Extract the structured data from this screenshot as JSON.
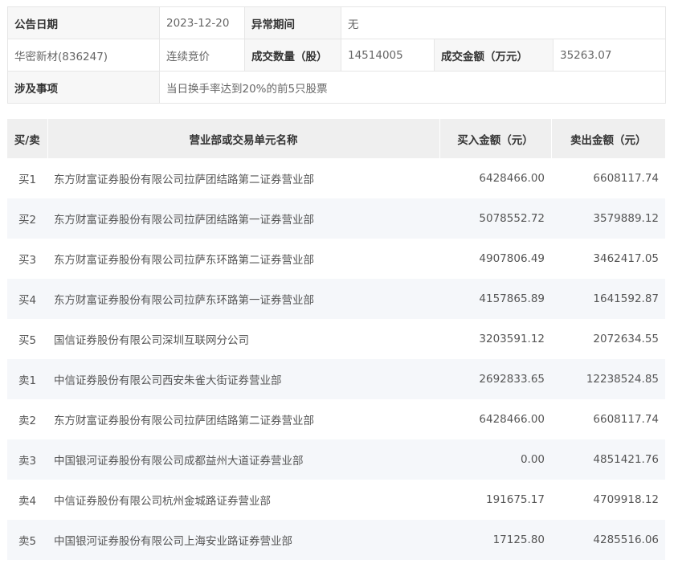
{
  "info": {
    "date_label": "公告日期",
    "date_value": "2023-12-20",
    "abnormal_label": "异常期间",
    "abnormal_value": "无",
    "stock_name": "华密新材(836247)",
    "trade_type": "连续竞价",
    "volume_label": "成交数量（股）",
    "volume_value": "14514005",
    "amount_label": "成交金额（万元）",
    "amount_value": "35263.07",
    "matter_label": "涉及事项",
    "matter_value": "当日换手率达到20%的前5只股票"
  },
  "table": {
    "headers": {
      "side": "买/卖",
      "name": "营业部或交易单元名称",
      "buy": "买入金额（元）",
      "sell": "卖出金额（元）"
    },
    "rows": [
      {
        "side": "买1",
        "name": "东方财富证券股份有限公司拉萨团结路第二证券营业部",
        "buy": "6428466.00",
        "sell": "6608117.74"
      },
      {
        "side": "买2",
        "name": "东方财富证券股份有限公司拉萨团结路第一证券营业部",
        "buy": "5078552.72",
        "sell": "3579889.12"
      },
      {
        "side": "买3",
        "name": "东方财富证券股份有限公司拉萨东环路第二证券营业部",
        "buy": "4907806.49",
        "sell": "3462417.05"
      },
      {
        "side": "买4",
        "name": "东方财富证券股份有限公司拉萨东环路第一证券营业部",
        "buy": "4157865.89",
        "sell": "1641592.87"
      },
      {
        "side": "买5",
        "name": "国信证券股份有限公司深圳互联网分公司",
        "buy": "3203591.12",
        "sell": "2072634.55"
      },
      {
        "side": "卖1",
        "name": "中信证券股份有限公司西安朱雀大街证券营业部",
        "buy": "2692833.65",
        "sell": "12238524.85"
      },
      {
        "side": "卖2",
        "name": "东方财富证券股份有限公司拉萨团结路第二证券营业部",
        "buy": "6428466.00",
        "sell": "6608117.74"
      },
      {
        "side": "卖3",
        "name": "中国银河证券股份有限公司成都益州大道证券营业部",
        "buy": "0.00",
        "sell": "4851421.76"
      },
      {
        "side": "卖4",
        "name": "中信证券股份有限公司杭州金城路证券营业部",
        "buy": "191675.17",
        "sell": "4709918.12"
      },
      {
        "side": "卖5",
        "name": "中国银河证券股份有限公司上海安业路证券营业部",
        "buy": "17125.80",
        "sell": "4285516.06"
      }
    ]
  }
}
